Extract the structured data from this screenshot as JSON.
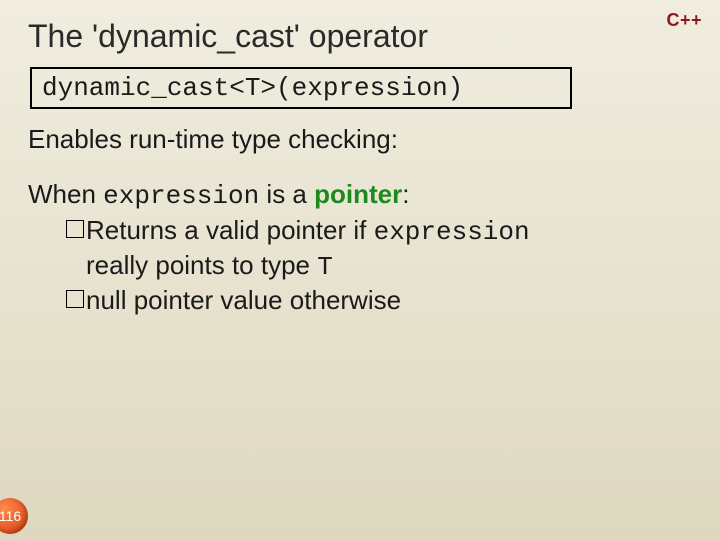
{
  "logo": "C++",
  "title": "The 'dynamic_cast' operator",
  "syntax": "dynamic_cast<T>(expression)",
  "line_enables": "Enables run-time type checking:",
  "when_prefix": "When ",
  "when_expr": "expression",
  "when_mid": " is a ",
  "when_pointer": "pointer",
  "when_colon": ":",
  "b1_a": "Returns a valid pointer if ",
  "b1_expr": "expression",
  "b1_b_indent": "really points to type ",
  "b1_T": "T",
  "b2": "null pointer value otherwise",
  "page_number": "116"
}
